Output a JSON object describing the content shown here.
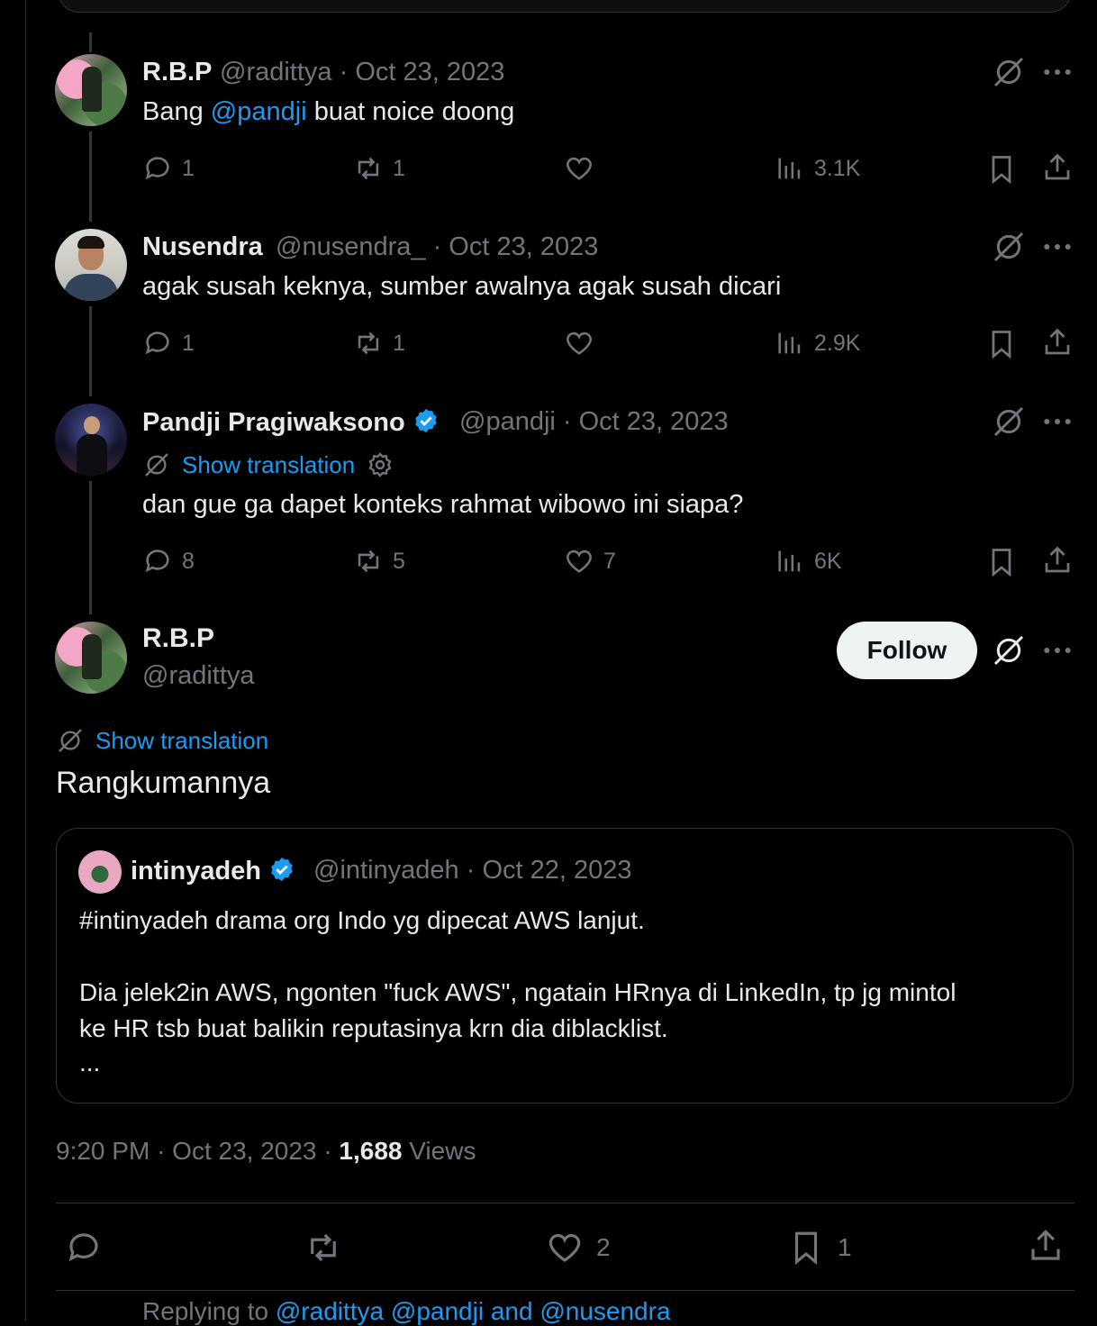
{
  "tweets": [
    {
      "name": "R.B.P",
      "handle": "@radittya",
      "date": "Oct 23, 2023",
      "text_before": "Bang ",
      "mention": "@pandji",
      "text_after": " buat noice doong",
      "replies": "1",
      "retweets": "1",
      "likes": "",
      "views": "3.1K"
    },
    {
      "name": "Nusendra",
      "handle": "@nusendra_",
      "date": "Oct 23, 2023",
      "text": "agak susah keknya, sumber awalnya agak susah dicari",
      "replies": "1",
      "retweets": "1",
      "likes": "",
      "views": "2.9K"
    },
    {
      "name": "Pandji Pragiwaksono",
      "handle": "@pandji",
      "date": "Oct 23, 2023",
      "show_translation": "Show translation",
      "text": "dan gue ga dapet konteks rahmat wibowo ini siapa?",
      "replies": "8",
      "retweets": "5",
      "likes": "7",
      "views": "6K"
    }
  ],
  "main_tweet": {
    "name": "R.B.P",
    "handle": "@radittya",
    "follow_label": "Follow",
    "show_translation": "Show translation",
    "text": "Rangkumannya",
    "quote": {
      "name": "intinyadeh",
      "handle": "@intinyadeh",
      "date": "Oct 22, 2023",
      "lines": [
        "#intinyadeh drama org Indo yg dipecat AWS lanjut.",
        "",
        "Dia jelek2in AWS, ngonten \"fuck AWS\", ngatain HRnya di LinkedIn, tp jg mintol",
        "ke HR tsb buat balikin reputasinya krn dia diblacklist.",
        "..."
      ]
    },
    "time": "9:20 PM",
    "date": "Oct 23, 2023",
    "views_count": "1,688",
    "views_label": "Views",
    "actions": {
      "replies": "",
      "retweets": "",
      "likes": "2",
      "bookmarks": "1"
    }
  },
  "replying": {
    "prefix": "Replying to ",
    "mentions": "@radittya @pandji and @nusendra"
  },
  "colors": {
    "background": "#000000",
    "accent": "#1d9bf0",
    "muted": "#71767b",
    "text": "#e7e9ea",
    "border": "#2f3336"
  }
}
